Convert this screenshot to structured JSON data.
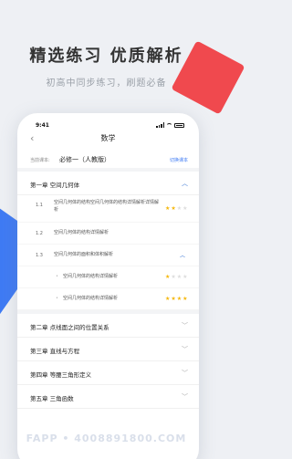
{
  "headline": "精选练习 优质解析",
  "subline": "初高中同步练习，刷题必备",
  "status": {
    "time": "9:41"
  },
  "nav": {
    "title": "数学",
    "back": "‹"
  },
  "textbook": {
    "label": "当前课本:",
    "value": "必修一（人教版）",
    "switch_label": "切换课本"
  },
  "chapters": [
    {
      "title": "第一章  空间几何体",
      "expanded": true
    },
    {
      "title": "第二章  点线面之间的位置关系",
      "expanded": false
    },
    {
      "title": "第三章  直线与方程",
      "expanded": false
    },
    {
      "title": "第四章  等腰三角形定义",
      "expanded": false
    },
    {
      "title": "第五章  三角函数",
      "expanded": false
    }
  ],
  "sections": [
    {
      "num": "1.1",
      "title": "空间几何体的结构空间几何体的结构详情解析详情解析",
      "stars": 2
    },
    {
      "num": "1.2",
      "title": "空间几何体的结构详情解析",
      "stars": 0
    },
    {
      "num": "1.3",
      "title": "空间几何体的面积和体积解析",
      "stars": 0
    }
  ],
  "subsections": [
    {
      "title": "空间几何体的结构详情解析",
      "stars": 1
    },
    {
      "title": "空间几何体的结构详情解析",
      "stars": 4
    }
  ],
  "icons": {
    "chevron_up": "︿",
    "chevron_down": "﹀",
    "star": "★",
    "dot": "•"
  },
  "colors": {
    "accent": "#3f7bf4",
    "star": "#f5b70a",
    "red": "#f0494e"
  },
  "watermark": "FAPP • 4008891800.COM"
}
